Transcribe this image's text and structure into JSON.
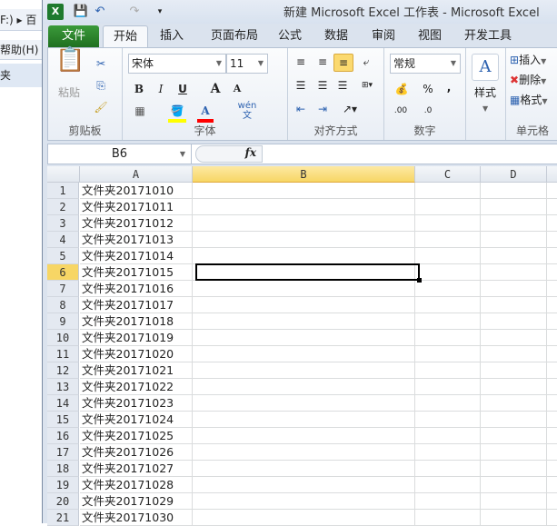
{
  "background_window": {
    "address": "F:) ▸ 百",
    "menu": "帮助(H)",
    "item": "夹"
  },
  "title": "新建 Microsoft Excel 工作表 - Microsoft Excel",
  "tabs": [
    "文件",
    "开始",
    "插入",
    "页面布局",
    "公式",
    "数据",
    "审阅",
    "视图",
    "开发工具"
  ],
  "ribbon": {
    "clipboard": {
      "paste": "粘贴",
      "label": "剪贴板"
    },
    "font": {
      "name": "宋体",
      "size": "11",
      "bold": "B",
      "italic": "I",
      "underline": "U",
      "grow": "A",
      "shrink": "A",
      "color": "A",
      "phonetic": "wén文",
      "label": "字体",
      "fill_color": "#ffff00",
      "font_color": "#ff0000"
    },
    "alignment": {
      "label": "对齐方式"
    },
    "number": {
      "format": "常规",
      "percent": "%",
      "comma": ",",
      "inc_decimal": ".00",
      "dec_decimal": ".0",
      "label": "数字"
    },
    "styles": {
      "label": "样式"
    },
    "cells": {
      "insert": "插入",
      "delete": "删除",
      "format": "格式",
      "label": "单元格"
    }
  },
  "formula_bar": {
    "name_box": "B6",
    "fx": "fx",
    "value": ""
  },
  "columns": [
    "A",
    "B",
    "C",
    "D"
  ],
  "rows": [
    {
      "n": "1",
      "a": "文件夹20171010"
    },
    {
      "n": "2",
      "a": "文件夹20171011"
    },
    {
      "n": "3",
      "a": "文件夹20171012"
    },
    {
      "n": "4",
      "a": "文件夹20171013"
    },
    {
      "n": "5",
      "a": "文件夹20171014"
    },
    {
      "n": "6",
      "a": "文件夹20171015"
    },
    {
      "n": "7",
      "a": "文件夹20171016"
    },
    {
      "n": "8",
      "a": "文件夹20171017"
    },
    {
      "n": "9",
      "a": "文件夹20171018"
    },
    {
      "n": "10",
      "a": "文件夹20171019"
    },
    {
      "n": "11",
      "a": "文件夹20171020"
    },
    {
      "n": "12",
      "a": "文件夹20171021"
    },
    {
      "n": "13",
      "a": "文件夹20171022"
    },
    {
      "n": "14",
      "a": "文件夹20171023"
    },
    {
      "n": "15",
      "a": "文件夹20171024"
    },
    {
      "n": "16",
      "a": "文件夹20171025"
    },
    {
      "n": "17",
      "a": "文件夹20171026"
    },
    {
      "n": "18",
      "a": "文件夹20171027"
    },
    {
      "n": "19",
      "a": "文件夹20171028"
    },
    {
      "n": "20",
      "a": "文件夹20171029"
    },
    {
      "n": "21",
      "a": "文件夹20171030"
    }
  ],
  "selected_row": "6",
  "selected_col": "B"
}
